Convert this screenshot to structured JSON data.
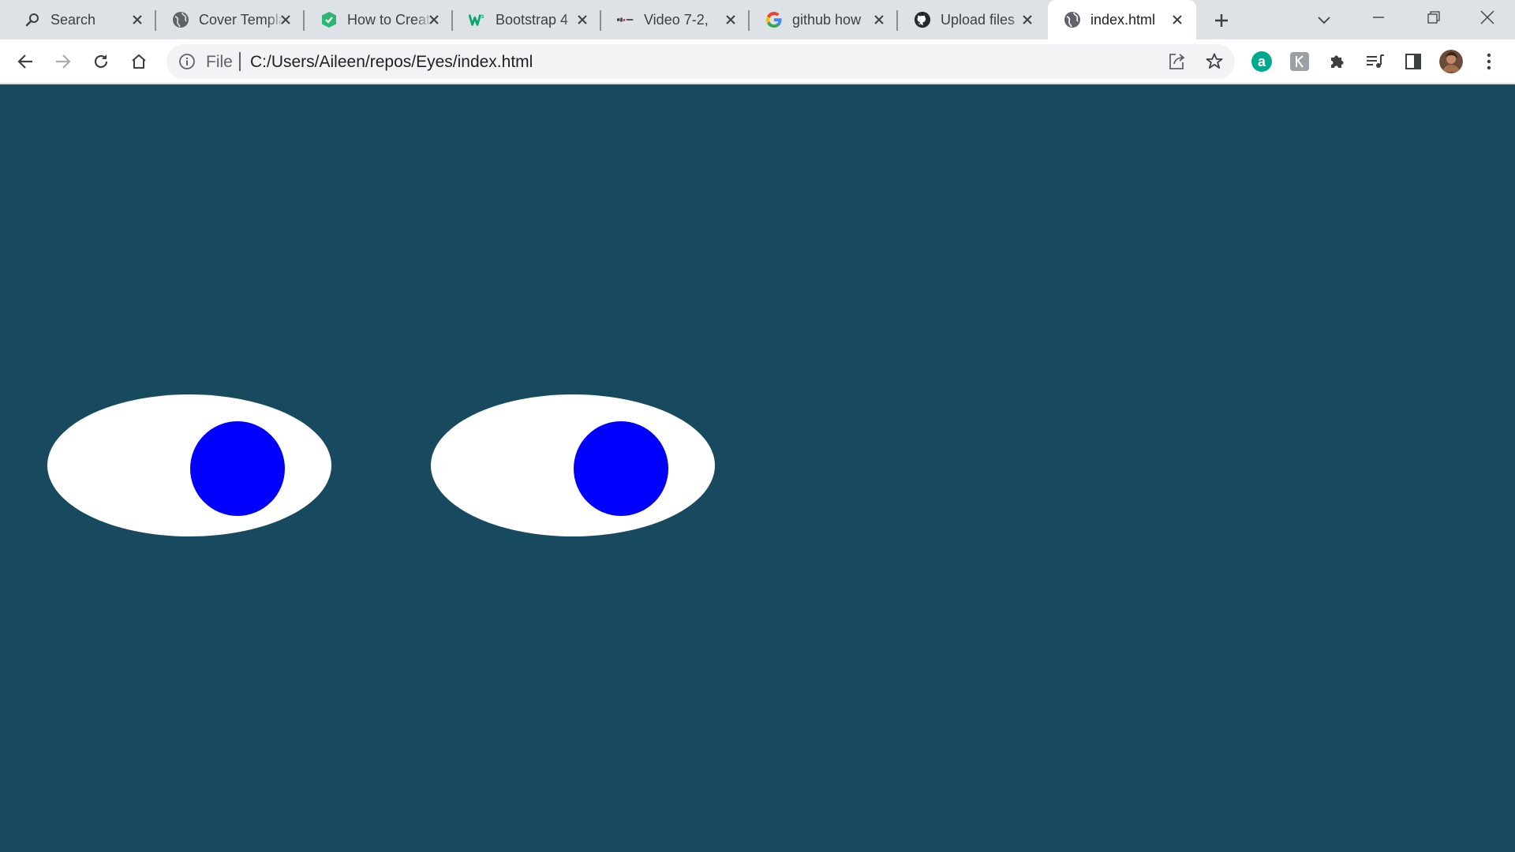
{
  "tabs": [
    {
      "title": "Search",
      "icon": "search-icon"
    },
    {
      "title": "Cover Template",
      "icon": "globe-icon"
    },
    {
      "title": "How to Create",
      "icon": "shield-icon"
    },
    {
      "title": "Bootstrap 4",
      "icon": "w3-logo-icon"
    },
    {
      "title": "Video 7-2,",
      "icon": "video-site-icon"
    },
    {
      "title": "github how",
      "icon": "google-icon"
    },
    {
      "title": "Upload files",
      "icon": "github-icon"
    },
    {
      "title": "index.html",
      "icon": "globe-icon",
      "active": true
    }
  ],
  "address_bar": {
    "scheme_label": "File",
    "url": "C:/Users/Aileen/repos/Eyes/index.html"
  },
  "colors": {
    "page_background": "#174a5e",
    "eye_white": "#ffffff",
    "pupil": "#0000ff"
  },
  "eyes": [
    {
      "name": "left-eye"
    },
    {
      "name": "right-eye"
    }
  ]
}
